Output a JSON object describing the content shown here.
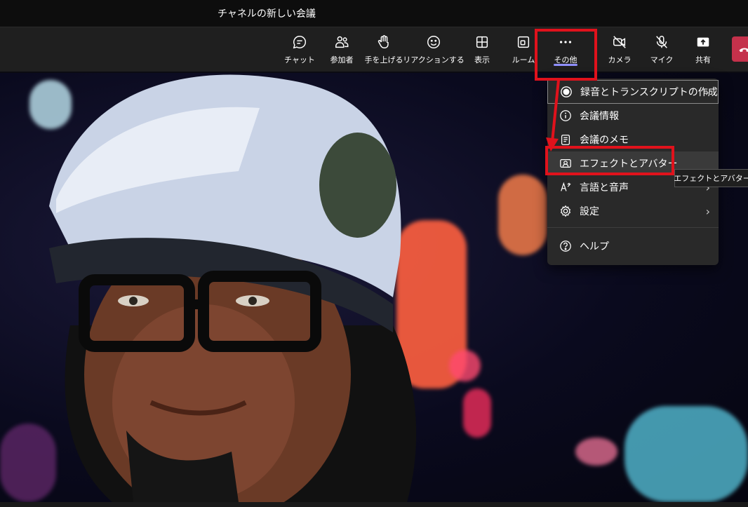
{
  "window": {
    "title": "チャネルの新しい会議"
  },
  "toolbar": {
    "items": [
      {
        "label": "チャット",
        "icon": "chat-icon"
      },
      {
        "label": "参加者",
        "icon": "people-icon"
      },
      {
        "label": "手を上げる",
        "icon": "raise-hand-icon"
      },
      {
        "label": "リアクションする",
        "icon": "reaction-icon"
      },
      {
        "label": "表示",
        "icon": "view-grid-icon"
      },
      {
        "label": "ルーム",
        "icon": "rooms-icon"
      },
      {
        "label": "その他",
        "icon": "more-icon"
      },
      {
        "label": "カメラ",
        "icon": "camera-off-icon"
      },
      {
        "label": "マイク",
        "icon": "mic-off-icon"
      },
      {
        "label": "共有",
        "icon": "share-icon"
      }
    ],
    "leave_color": "#c4314b",
    "active_underline_color": "#8f8fff"
  },
  "menu": {
    "items": [
      {
        "label": "録音とトランスクリプトの作成",
        "icon": "record-icon",
        "has_submenu": true
      },
      {
        "label": "会議情報",
        "icon": "info-icon",
        "has_submenu": false
      },
      {
        "label": "会議のメモ",
        "icon": "notes-icon",
        "has_submenu": false
      },
      {
        "label": "エフェクトとアバター",
        "icon": "effects-avatar-icon",
        "has_submenu": false
      },
      {
        "label": "言語と音声",
        "icon": "language-speech-icon",
        "has_submenu": true
      },
      {
        "label": "設定",
        "icon": "settings-gear-icon",
        "has_submenu": true
      },
      {
        "label": "ヘルプ",
        "icon": "help-icon",
        "has_submenu": false
      }
    ],
    "chevron": "›"
  },
  "tooltip": {
    "text": "エフェクトとアバター"
  },
  "annotation": {
    "highlight_color": "#e0121c"
  }
}
